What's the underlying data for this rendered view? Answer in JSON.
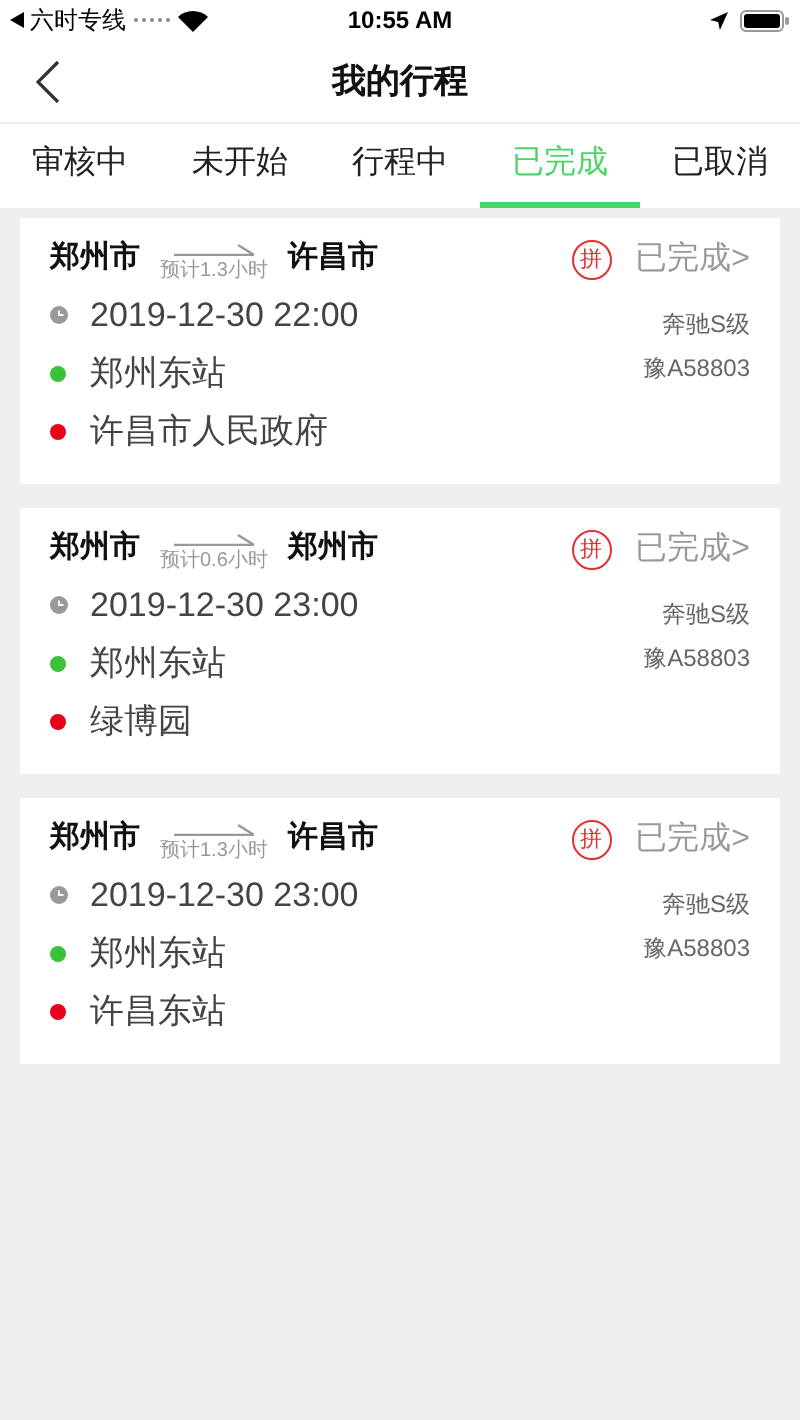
{
  "status_bar": {
    "carrier": "六时专线",
    "time": "10:55 AM"
  },
  "nav": {
    "title": "我的行程"
  },
  "tabs": [
    {
      "label": "审核中",
      "selected": false
    },
    {
      "label": "未开始",
      "selected": false
    },
    {
      "label": "行程中",
      "selected": false
    },
    {
      "label": "已完成",
      "selected": true
    },
    {
      "label": "已取消",
      "selected": false
    }
  ],
  "trips": [
    {
      "from": "郑州市",
      "eta": "预计1.3小时",
      "to": "许昌市",
      "badge": "拼",
      "status": "已完成>",
      "time": "2019-12-30 22:00",
      "stops": [
        {
          "name": "郑州东站",
          "color": "#3cc13b"
        },
        {
          "name": "许昌市人民政府",
          "color": "#e8001c"
        }
      ],
      "car": "奔驰S级",
      "plate": "豫A58803"
    },
    {
      "from": "郑州市",
      "eta": "预计0.6小时",
      "to": "郑州市",
      "badge": "拼",
      "status": "已完成>",
      "time": "2019-12-30 23:00",
      "stops": [
        {
          "name": "郑州东站",
          "color": "#3cc13b"
        },
        {
          "name": "绿博园",
          "color": "#e8001c"
        }
      ],
      "car": "奔驰S级",
      "plate": "豫A58803"
    },
    {
      "from": "郑州市",
      "eta": "预计1.3小时",
      "to": "许昌市",
      "badge": "拼",
      "status": "已完成>",
      "time": "2019-12-30 23:00",
      "stops": [
        {
          "name": "郑州东站",
          "color": "#3cc13b"
        },
        {
          "name": "许昌东站",
          "color": "#e8001c"
        }
      ],
      "car": "奔驰S级",
      "plate": "豫A58803"
    }
  ]
}
